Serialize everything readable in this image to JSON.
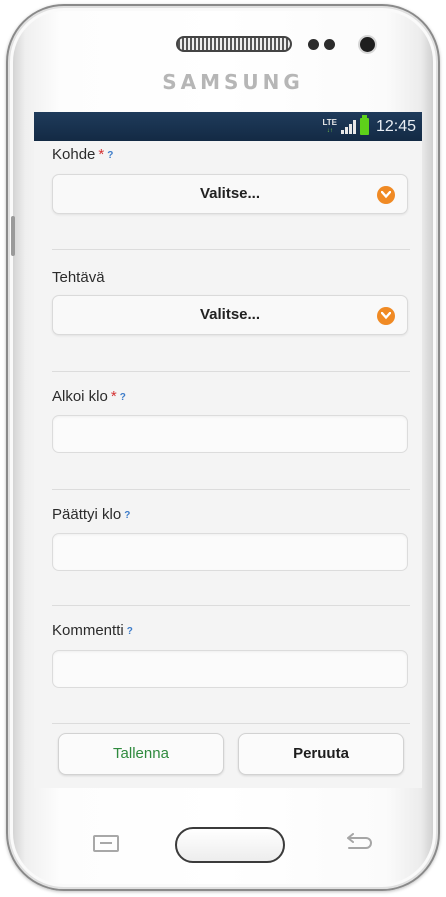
{
  "device": {
    "brand": "SAMSUNG"
  },
  "statusbar": {
    "network": "LTE",
    "time": "12:45"
  },
  "form": {
    "kohde": {
      "label": "Kohde",
      "required": "*",
      "help": "?",
      "value": "Valitse..."
    },
    "tehtava": {
      "label": "Tehtävä",
      "value": "Valitse..."
    },
    "alkoi": {
      "label": "Alkoi klo",
      "required": "*",
      "help": "?",
      "value": ""
    },
    "paattyi": {
      "label": "Päättyi klo",
      "help": "?",
      "value": ""
    },
    "kommentti": {
      "label": "Kommentti",
      "help": "?",
      "value": ""
    }
  },
  "buttons": {
    "save": "Tallenna",
    "cancel": "Peruuta"
  },
  "colors": {
    "statusbar": "#1f3b5b",
    "accent": "#f08a24",
    "required": "#d43131",
    "help": "#3d7cc9",
    "save_text": "#2f8a3e"
  }
}
